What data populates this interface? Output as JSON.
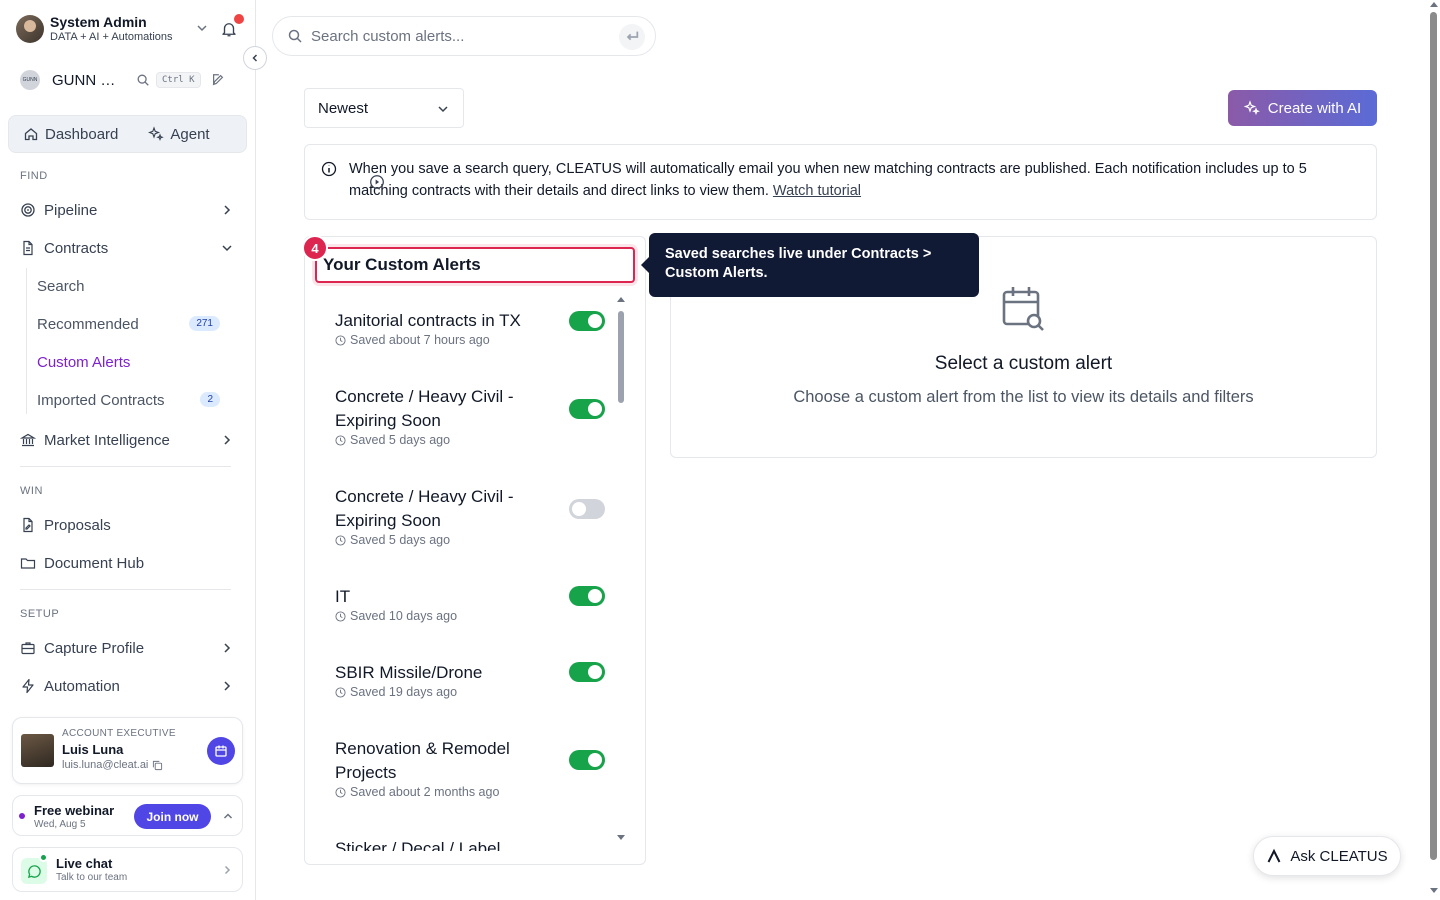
{
  "user": {
    "name": "System Admin",
    "subtitle": "DATA + AI + Automations"
  },
  "org": {
    "logo_text": "GUNN",
    "name": "GUNN C...",
    "shortcut": "Ctrl K"
  },
  "segment": {
    "dashboard": "Dashboard",
    "agent": "Agent"
  },
  "sidebar": {
    "find_label": "FIND",
    "pipeline": "Pipeline",
    "contracts": "Contracts",
    "contracts_sub": [
      {
        "label": "Search"
      },
      {
        "label": "Recommended",
        "count": "271"
      },
      {
        "label": "Custom Alerts"
      },
      {
        "label": "Imported Contracts",
        "count": "2"
      }
    ],
    "market_intelligence": "Market Intelligence",
    "win_label": "WIN",
    "proposals": "Proposals",
    "document_hub": "Document Hub",
    "setup_label": "SETUP",
    "capture_profile": "Capture Profile",
    "automation": "Automation"
  },
  "account_exec": {
    "role": "ACCOUNT EXECUTIVE",
    "name": "Luis Luna",
    "email": "luis.luna@cleat.ai"
  },
  "webinar": {
    "title": "Free webinar",
    "date": "Wed, Aug 5",
    "cta": "Join now"
  },
  "live_chat": {
    "title": "Live chat",
    "subtitle": "Talk to our team"
  },
  "search": {
    "placeholder": "Search custom alerts..."
  },
  "sort": {
    "value": "Newest"
  },
  "create_button": "Create with AI",
  "info": {
    "text": "When you save a search query, CLEATUS will automatically email you when new matching contracts are published. Each notification includes up to 5 matching contracts with their details and direct links to view them.",
    "link": "Watch tutorial"
  },
  "list": {
    "heading": "Your Custom Alerts",
    "step": "4",
    "items": [
      {
        "title": "Janitorial contracts in TX",
        "saved": "Saved about 7 hours ago",
        "enabled": true
      },
      {
        "title": "Concrete / Heavy Civil - Expiring Soon",
        "saved": "Saved 5 days ago",
        "enabled": true
      },
      {
        "title": "Concrete / Heavy Civil - Expiring Soon",
        "saved": "Saved 5 days ago",
        "enabled": false
      },
      {
        "title": "IT",
        "saved": "Saved 10 days ago",
        "enabled": true
      },
      {
        "title": "SBIR Missile/Drone",
        "saved": "Saved 19 days ago",
        "enabled": true
      },
      {
        "title": "Renovation & Remodel Projects",
        "saved": "Saved about 2 months ago",
        "enabled": true
      },
      {
        "title": "Sticker / Decal / Label",
        "saved": "",
        "enabled": true
      }
    ]
  },
  "tooltip": "Saved searches live under Contracts > Custom Alerts.",
  "detail": {
    "title": "Select a custom alert",
    "subtitle": "Choose a custom alert from the list to view its details and filters"
  },
  "ask": "Ask CLEATUS",
  "colors": {
    "accent_purple": "#7e22ce",
    "toggle_on": "#16a34a",
    "highlight_red": "#dc2650",
    "tooltip_bg": "#111a35"
  }
}
